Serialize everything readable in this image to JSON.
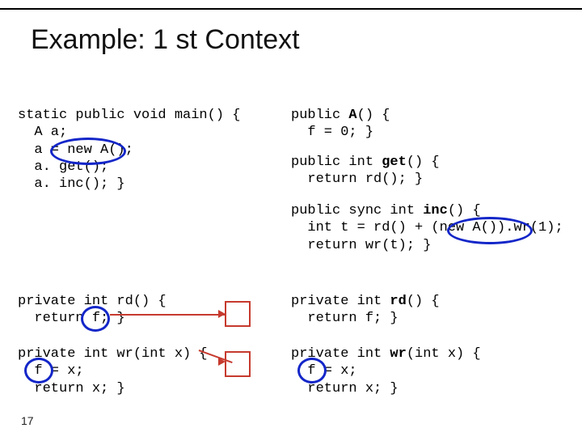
{
  "title": "Example: 1 st Context",
  "page_number": "17",
  "left": {
    "main": "static public void main() {\n  A a;\n  a = new A();\n  a. get();\n  a. inc(); }",
    "rd": "private int rd() {\n  return f; }",
    "wr": "private int wr(int x) {\n  f = x;\n  return x; }"
  },
  "right": {
    "ctor_pre": "public ",
    "ctor_name": "A",
    "ctor_post": "() {\n  f = 0; }",
    "get_pre": "public int ",
    "get_name": "get",
    "get_post": "() {\n  return rd(); }",
    "inc_pre": "public sync int ",
    "inc_name": "inc",
    "inc_post": "() {\n  int t = rd() + (new A()).wr(1);\n  return wr(t); }",
    "rd_pre": "private int ",
    "rd_name": "rd",
    "rd_post": "() {\n  return f; }",
    "wr_pre": "private int ",
    "wr_name": "wr",
    "wr_post": "(int x) {\n  f = x;\n  return x; }"
  }
}
